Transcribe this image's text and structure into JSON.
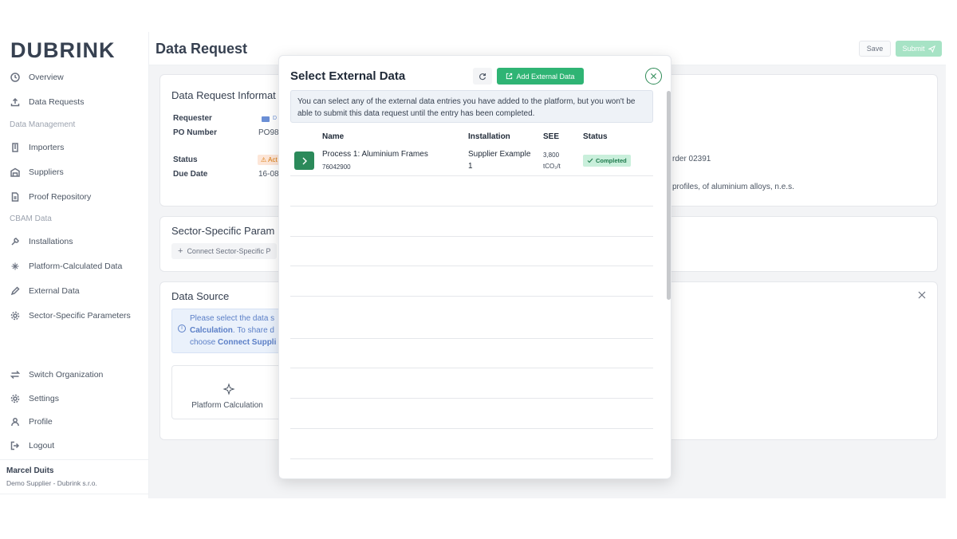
{
  "app": {
    "logo": "DUBRINK"
  },
  "sidebar": {
    "items_top": [
      {
        "label": "Overview",
        "icon": "clock-icon"
      },
      {
        "label": "Data Requests",
        "icon": "upload-icon"
      }
    ],
    "section_data_management": "Data Management",
    "items_dm": [
      {
        "label": "Importers",
        "icon": "building-icon"
      },
      {
        "label": "Suppliers",
        "icon": "warehouse-icon"
      },
      {
        "label": "Proof Repository",
        "icon": "file-icon"
      }
    ],
    "section_cbam": "CBAM Data",
    "items_cbam": [
      {
        "label": "Installations",
        "icon": "wrench-icon"
      },
      {
        "label": "Platform-Calculated Data",
        "icon": "sparkle-icon"
      },
      {
        "label": "External Data",
        "icon": "pencil-icon"
      },
      {
        "label": "Sector-Specific Parameters",
        "icon": "gear-icon"
      }
    ],
    "items_bottom": [
      {
        "label": "Switch Organization",
        "icon": "swap-icon"
      },
      {
        "label": "Settings",
        "icon": "gear-icon"
      },
      {
        "label": "Profile",
        "icon": "user-icon"
      },
      {
        "label": "Logout",
        "icon": "logout-icon"
      }
    ],
    "user": {
      "name": "Marcel Duits",
      "org": "Demo Supplier - Dubrink s.r.o."
    }
  },
  "header": {
    "title": "Data Request",
    "save_label": "Save",
    "submit_label": "Submit"
  },
  "request_info": {
    "title": "Data Request Informat",
    "requester_label": "Requester",
    "requester_value": "D",
    "po_label": "PO Number",
    "po_value": "PO98",
    "status_label": "Status",
    "status_value": "Act",
    "due_label": "Due Date",
    "due_value": "16-08",
    "order_text": "rder 02391",
    "product_text": "profiles, of aluminium alloys, n.e.s."
  },
  "sector_params": {
    "title": "Sector-Specific Param",
    "connect_label": "Connect Sector-Specific P"
  },
  "data_source": {
    "title": "Data Source",
    "info_line1": "Please select the data s",
    "info_line2_bold": "Calculation",
    "info_line2_rest": ". To share d",
    "info_line3_pre": "choose ",
    "info_line3_bold": "Connect Suppli",
    "platform_label": "Platform Calculation"
  },
  "modal": {
    "title": "Select External Data",
    "add_label": "Add External Data",
    "notice": "You can select any of the external data entries you have added to the platform, but you won't be able to submit this data request until the entry has been completed.",
    "columns": {
      "name": "Name",
      "installation": "Installation",
      "see": "SEE",
      "status": "Status"
    },
    "rows": [
      {
        "name": "Process 1: Aluminium Frames",
        "code": "76042900",
        "installation_line1": "Supplier Example",
        "installation_line2": "1",
        "see_value": "3,800",
        "see_unit": "tCO₂/t",
        "status": "Completed"
      }
    ]
  },
  "colors": {
    "accent_green": "#2fb474",
    "dark_green": "#2b8a5a",
    "submit_disabled": "#a7e3c5"
  }
}
